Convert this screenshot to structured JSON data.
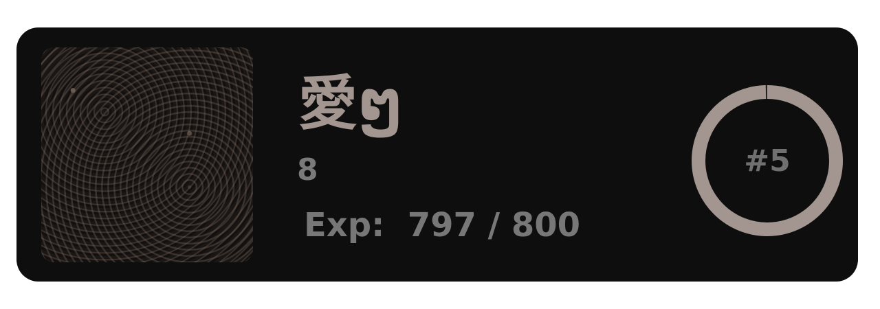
{
  "profile": {
    "name": "愛ໆ",
    "level": "8",
    "exp_label": "Exp:",
    "exp_current": 797,
    "exp_max": 800,
    "exp_text": "797 / 800",
    "rank": "#5",
    "avatar": "curly-hair-photo"
  },
  "colors": {
    "card_bg": "#0e0e0e",
    "ring_fill": "#a39690",
    "ring_track": "#222222",
    "name": "#a39690",
    "text_muted": "#777777"
  }
}
